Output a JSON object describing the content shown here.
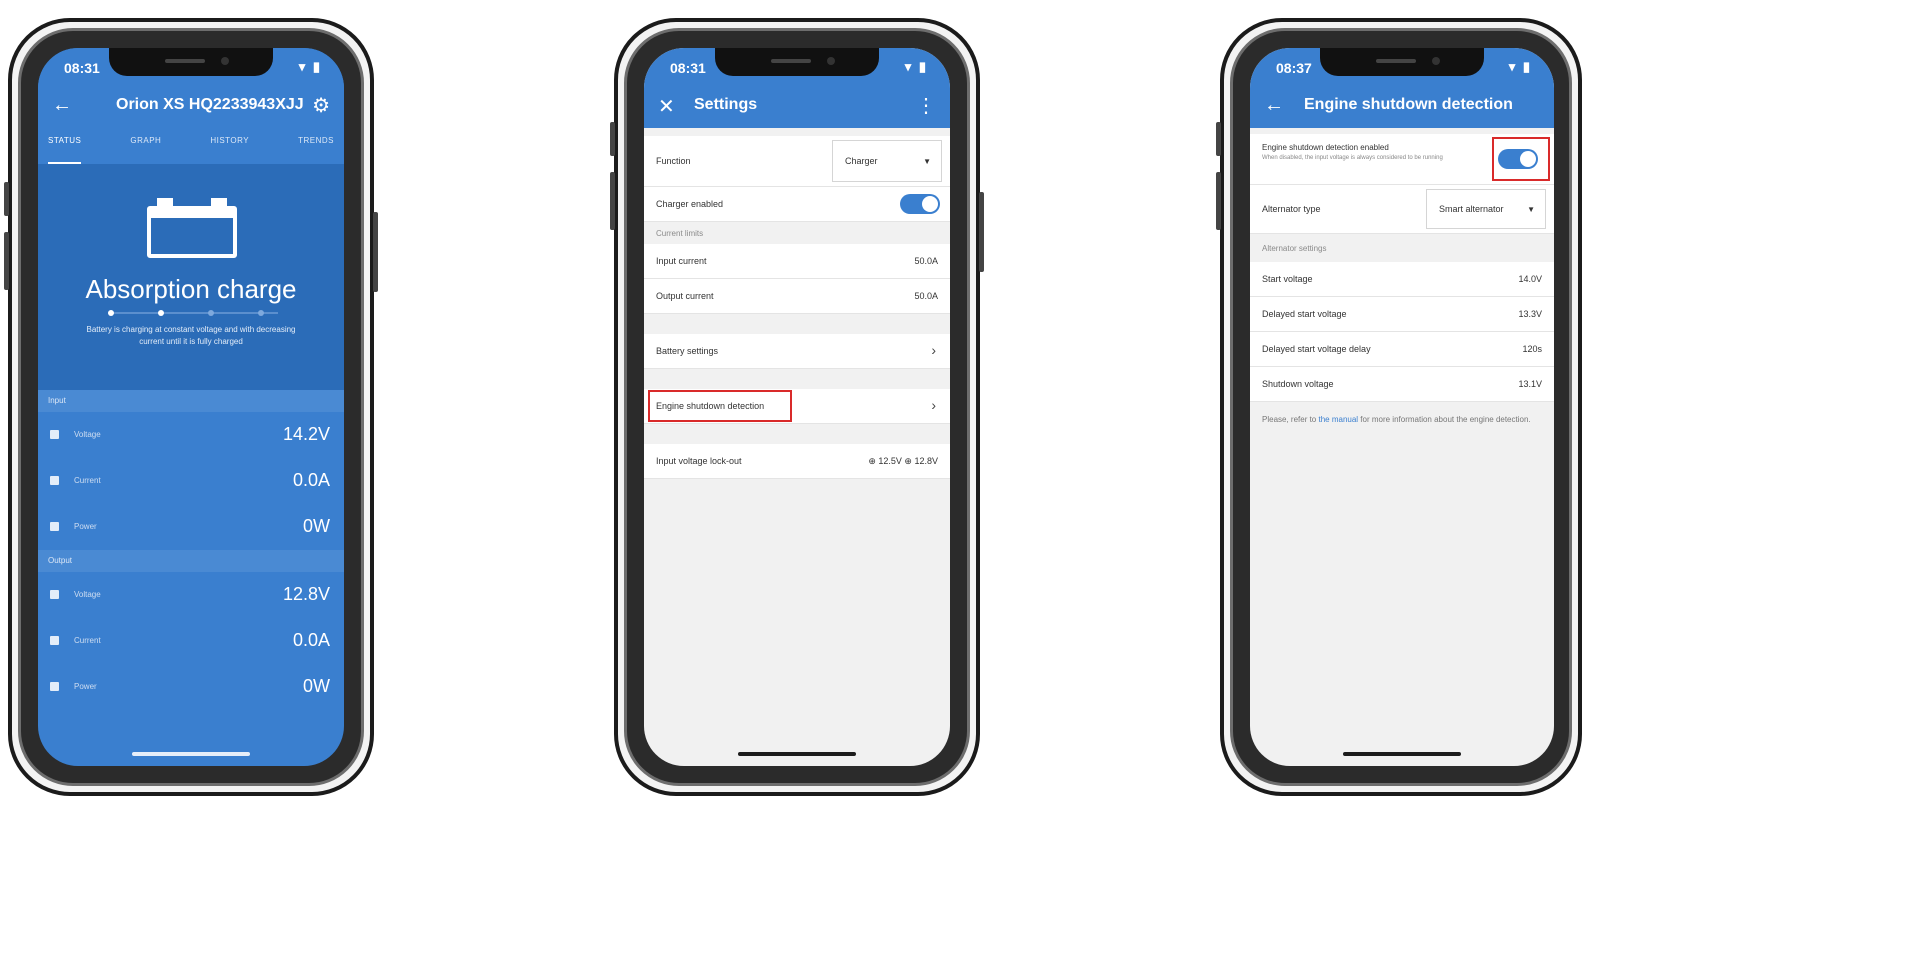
{
  "phone1": {
    "time": "08:31",
    "status_icons": "▾ ▮",
    "back_icon": "←",
    "title": "Orion XS HQ2233943XJJ",
    "settings_icon": "⚙",
    "tabs": [
      "STATUS",
      "GRAPH",
      "HISTORY",
      "TRENDS"
    ],
    "hero_title": "Absorption charge",
    "hero_desc": "Battery is charging at constant voltage and with decreasing current until it is fully charged",
    "input_label": "Input",
    "input_rows": [
      {
        "label": "Voltage",
        "value": "14.2V"
      },
      {
        "label": "Current",
        "value": "0.0A"
      },
      {
        "label": "Power",
        "value": "0W"
      }
    ],
    "output_label": "Output",
    "output_rows": [
      {
        "label": "Voltage",
        "value": "12.8V"
      },
      {
        "label": "Current",
        "value": "0.0A"
      },
      {
        "label": "Power",
        "value": "0W"
      }
    ]
  },
  "phone2": {
    "time": "08:31",
    "status_icons": "▾ ▮",
    "close_icon": "✕",
    "title": "Settings",
    "menu_icon": "⋮",
    "function_label": "Function",
    "function_value": "Charger",
    "charger_enabled_label": "Charger enabled",
    "current_limits_label": "Current limits",
    "input_current_label": "Input current",
    "input_current_value": "50.0A",
    "output_current_label": "Output current",
    "output_current_value": "50.0A",
    "battery_settings_label": "Battery settings",
    "engine_shutdown_label": "Engine shutdown detection",
    "input_lockout_label": "Input voltage lock-out",
    "input_lockout_value": "⊕ 12.5V  ⊕ 12.8V",
    "chevron": "›"
  },
  "phone3": {
    "time": "08:37",
    "status_icons": "▾ ▮",
    "back_icon": "←",
    "title": "Engine shutdown detection",
    "enabled_label": "Engine shutdown detection enabled",
    "enabled_desc": "When disabled, the input voltage is always considered to be running",
    "alternator_type_label": "Alternator type",
    "alternator_type_value": "Smart alternator",
    "alternator_settings_label": "Alternator settings",
    "rows": [
      {
        "label": "Start voltage",
        "value": "14.0V"
      },
      {
        "label": "Delayed start voltage",
        "value": "13.3V"
      },
      {
        "label": "Delayed start voltage delay",
        "value": "120s"
      },
      {
        "label": "Shutdown voltage",
        "value": "13.1V"
      }
    ],
    "note_before": "Please, refer to ",
    "note_link": "the manual",
    "note_after": " for more information about the engine detection."
  }
}
